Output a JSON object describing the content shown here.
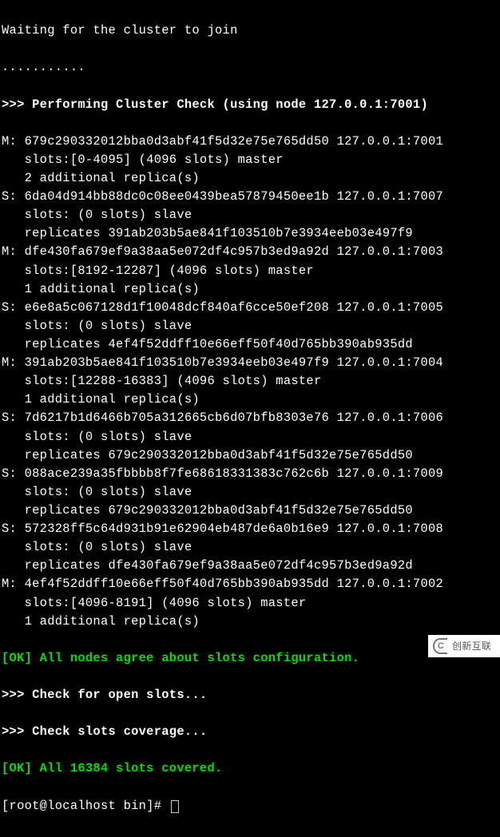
{
  "header": {
    "waiting": "Waiting for the cluster to join",
    "dots": "...........",
    "check": ">>> Performing Cluster Check (using node 127.0.0.1:7001)"
  },
  "nodes": [
    {
      "role": "M:",
      "id": "679c290332012bba0d3abf41f5d32e75e765dd50",
      "addr": "127.0.0.1:7001",
      "slots": "   slots:[0-4095] (4096 slots) master",
      "extra": "   2 additional replica(s)"
    },
    {
      "role": "S:",
      "id": "6da04d914bb88dc0c08ee0439bea57879450ee1b",
      "addr": "127.0.0.1:7007",
      "slots": "   slots: (0 slots) slave",
      "extra": "   replicates 391ab203b5ae841f103510b7e3934eeb03e497f9"
    },
    {
      "role": "M:",
      "id": "dfe430fa679ef9a38aa5e072df4c957b3ed9a92d",
      "addr": "127.0.0.1:7003",
      "slots": "   slots:[8192-12287] (4096 slots) master",
      "extra": "   1 additional replica(s)"
    },
    {
      "role": "S:",
      "id": "e6e8a5c067128d1f10048dcf840af6cce50ef208",
      "addr": "127.0.0.1:7005",
      "slots": "   slots: (0 slots) slave",
      "extra": "   replicates 4ef4f52ddff10e66eff50f40d765bb390ab935dd"
    },
    {
      "role": "M:",
      "id": "391ab203b5ae841f103510b7e3934eeb03e497f9",
      "addr": "127.0.0.1:7004",
      "slots": "   slots:[12288-16383] (4096 slots) master",
      "extra": "   1 additional replica(s)"
    },
    {
      "role": "S:",
      "id": "7d6217b1d6466b705a312665cb6d07bfb8303e76",
      "addr": "127.0.0.1:7006",
      "slots": "   slots: (0 slots) slave",
      "extra": "   replicates 679c290332012bba0d3abf41f5d32e75e765dd50"
    },
    {
      "role": "S:",
      "id": "088ace239a35fbbbb8f7fe68618331383c762c6b",
      "addr": "127.0.0.1:7009",
      "slots": "   slots: (0 slots) slave",
      "extra": "   replicates 679c290332012bba0d3abf41f5d32e75e765dd50"
    },
    {
      "role": "S:",
      "id": "572328ff5c64d931b91e62904eb487de6a0b16e9",
      "addr": "127.0.0.1:7008",
      "slots": "   slots: (0 slots) slave",
      "extra": "   replicates dfe430fa679ef9a38aa5e072df4c957b3ed9a92d"
    },
    {
      "role": "M:",
      "id": "4ef4f52ddff10e66eff50f40d765bb390ab935dd",
      "addr": "127.0.0.1:7002",
      "slots": "   slots:[4096-8191] (4096 slots) master",
      "extra": "   1 additional replica(s)"
    }
  ],
  "footer": {
    "ok1": "[OK] All nodes agree about slots configuration.",
    "openslots": ">>> Check for open slots...",
    "coverage": ">>> Check slots coverage...",
    "ok2": "[OK] All 16384 slots covered.",
    "prompt": "[root@localhost bin]# "
  },
  "watermark": {
    "text": "创新互联"
  }
}
